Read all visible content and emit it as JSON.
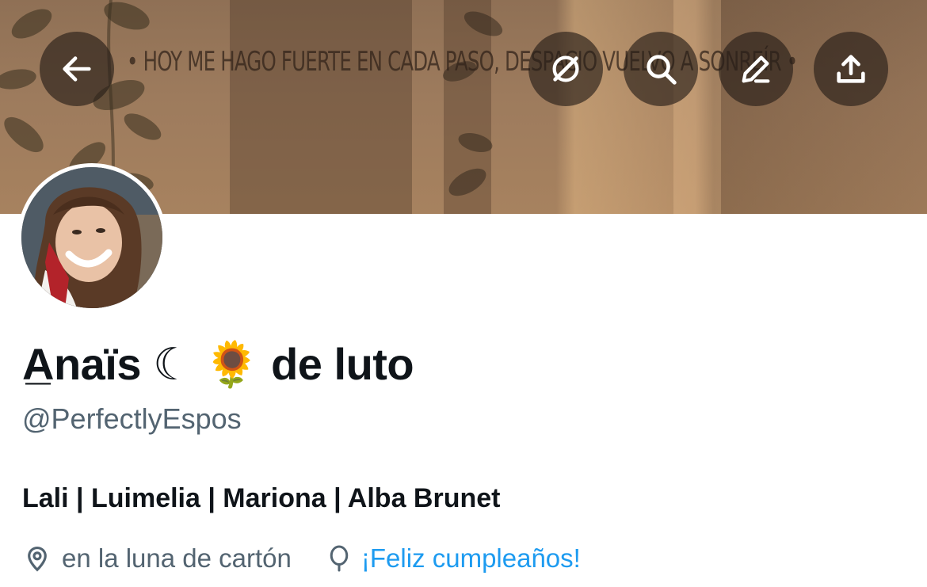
{
  "header": {
    "banner_text": "• HOY ME HAGO FUERTE EN CADA PASO, DESPACIO VUELVO A SONREÍR •",
    "buttons": [
      {
        "name": "back-button",
        "icon": "arrow-left-icon"
      },
      {
        "name": "grok-button",
        "icon": "grok-icon"
      },
      {
        "name": "search-button",
        "icon": "search-icon"
      },
      {
        "name": "edit-button",
        "icon": "pencil-icon"
      },
      {
        "name": "share-button",
        "icon": "share-icon"
      }
    ]
  },
  "profile": {
    "display_name": "A̲naïs ☾ 🌻 de luto",
    "handle": "@PerfectlyEspos",
    "bio": "Lali | Luimelia | Mariona | Alba Brunet",
    "location": "en la luna de cartón",
    "birthday_link": "¡Feliz cumpleaños!"
  },
  "colors": {
    "text_primary": "#0f1419",
    "text_secondary": "#536471",
    "link": "#1d9bf0"
  }
}
